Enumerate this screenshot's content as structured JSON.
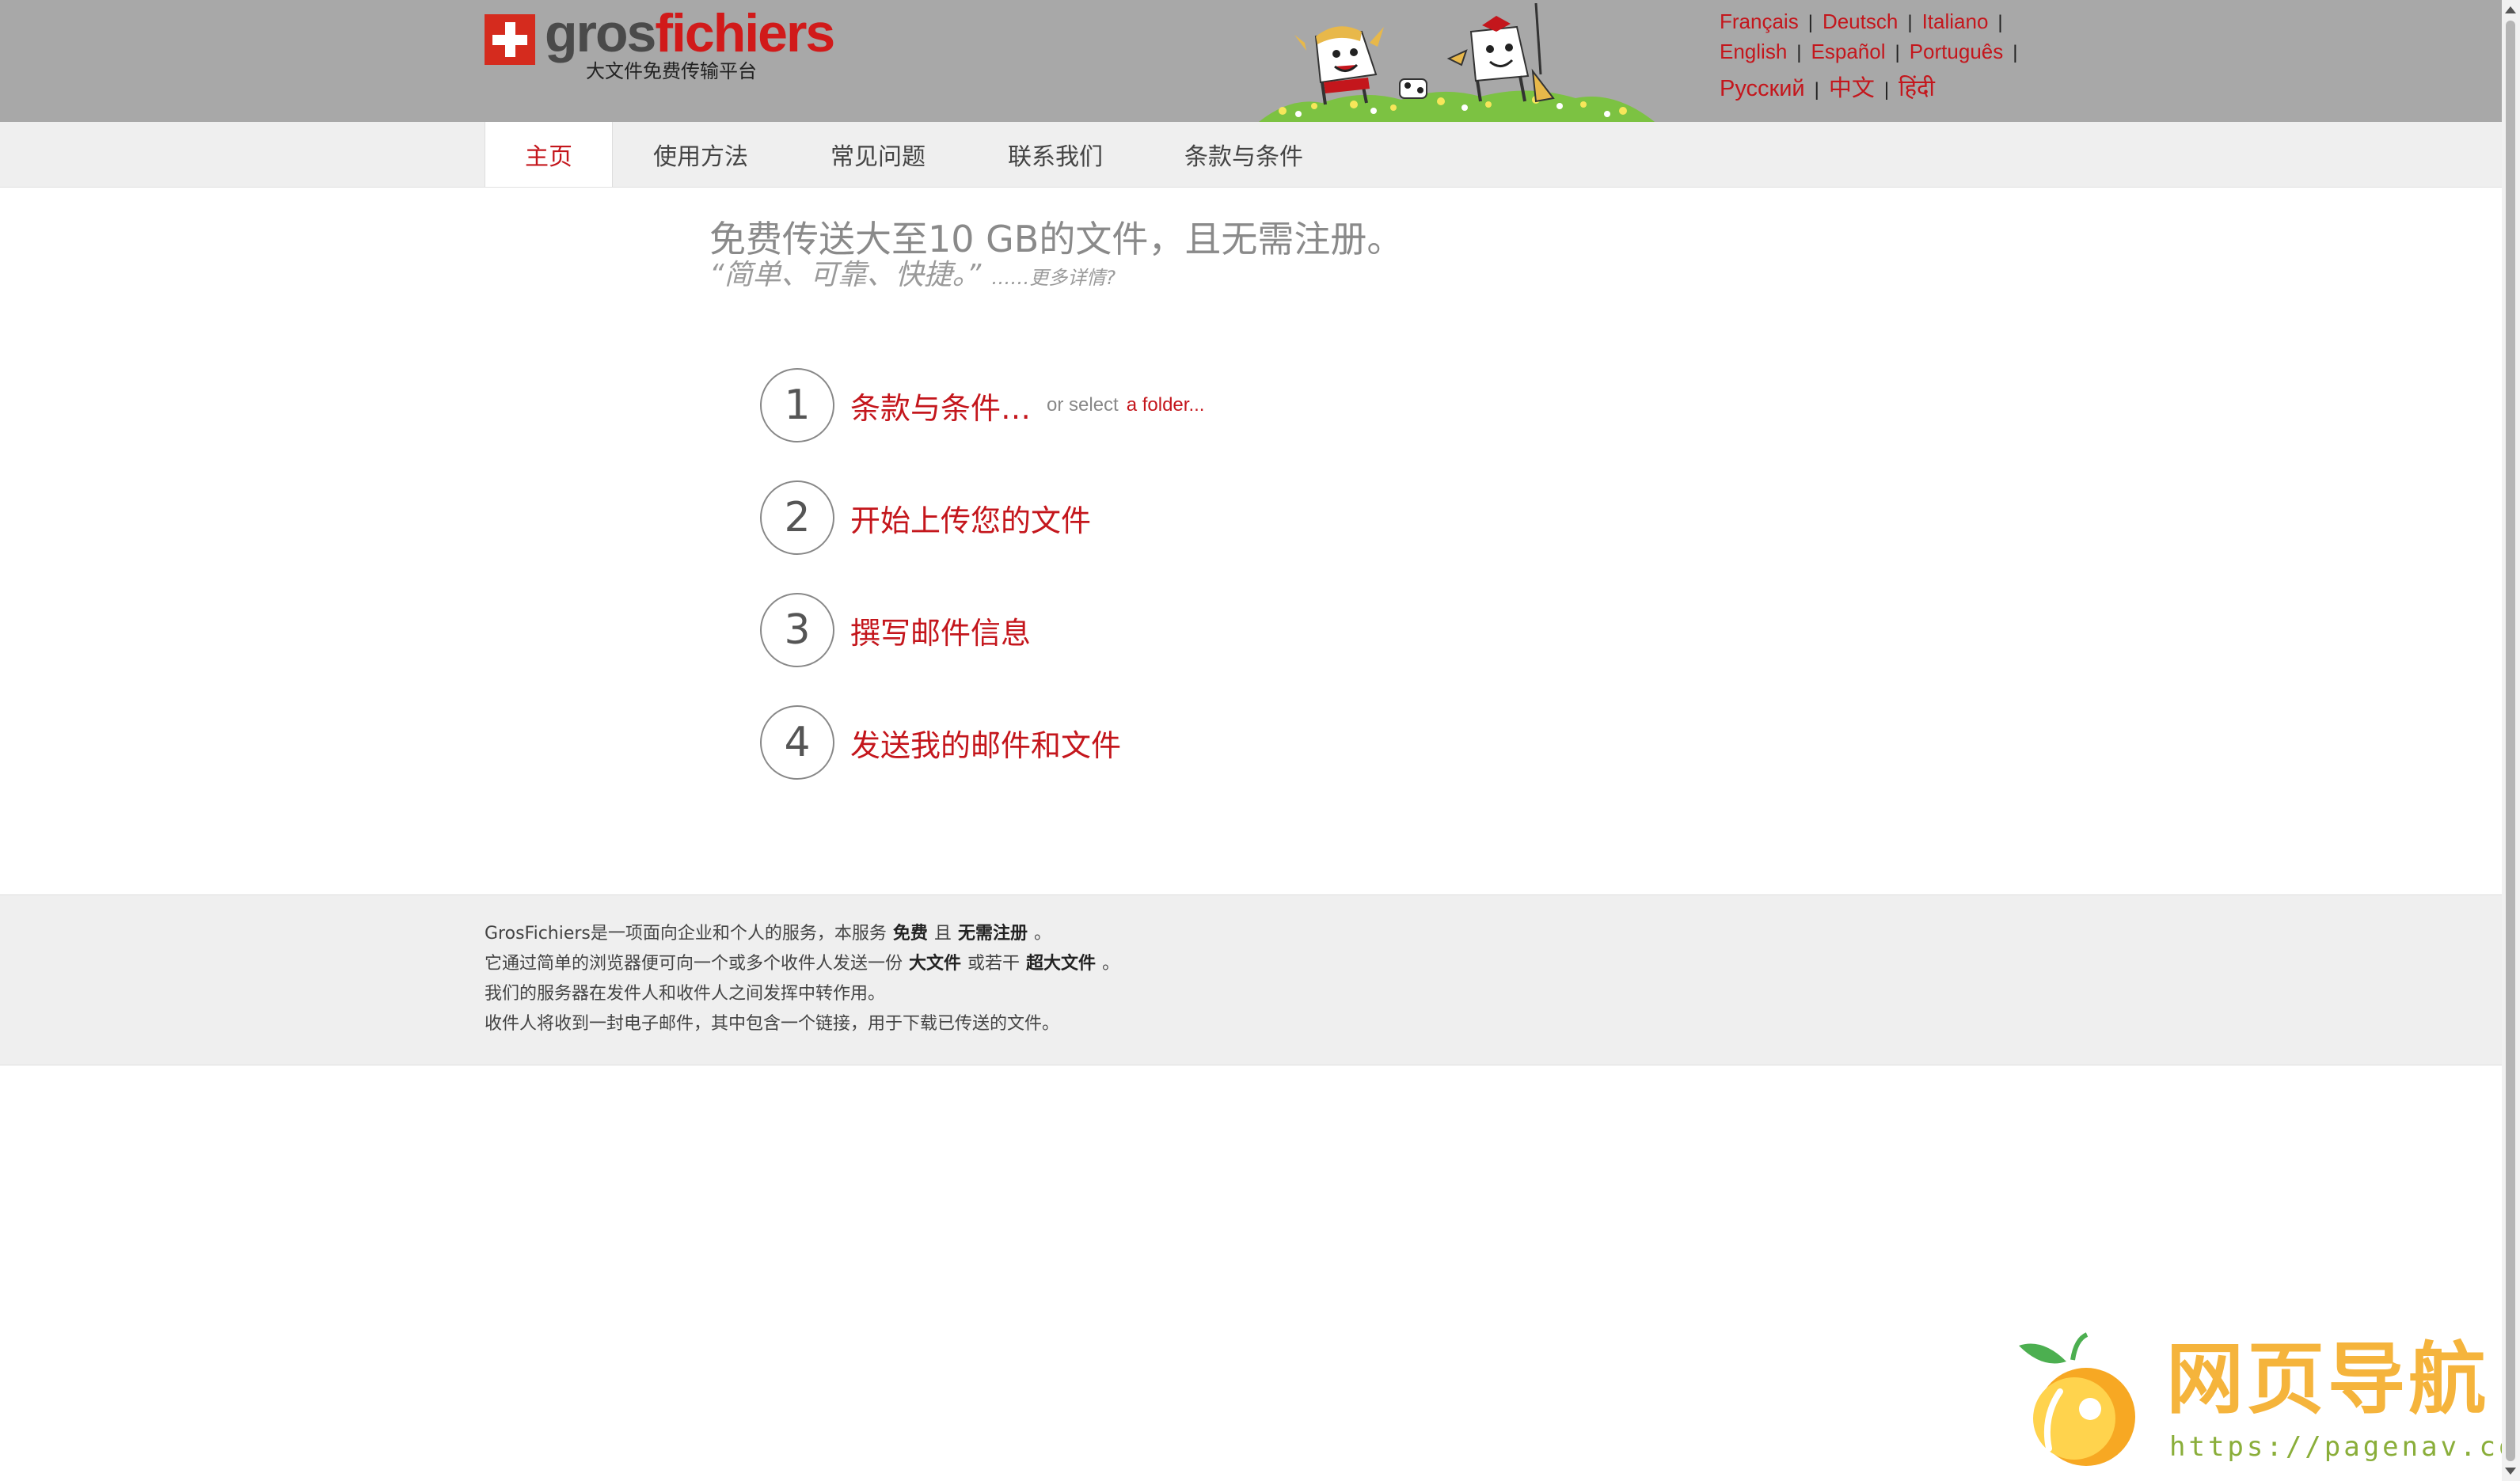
{
  "header": {
    "logo_part1": "gros",
    "logo_part2": "fichiers",
    "tagline": "大文件免费传输平台",
    "languages_row1": [
      "Français",
      "Deutsch",
      "Italiano"
    ],
    "languages_row2": [
      "English",
      "Español",
      "Português"
    ],
    "languages_row3": [
      "Русский",
      "中文",
      "हिंदी"
    ]
  },
  "nav": {
    "tabs": [
      {
        "label": "主页",
        "active": true
      },
      {
        "label": "使用方法",
        "active": false
      },
      {
        "label": "常见问题",
        "active": false
      },
      {
        "label": "联系我们",
        "active": false
      },
      {
        "label": "条款与条件",
        "active": false
      }
    ]
  },
  "main": {
    "headline": "免费传送大至10 GB的文件，且无需注册。",
    "subline_quote": "“简单、可靠、快捷。”",
    "subline_more": "……更多详情?",
    "steps": [
      {
        "number": "1",
        "label": "条款与条件…",
        "extra": "or select",
        "extra_link": "a folder..."
      },
      {
        "number": "2",
        "label": "开始上传您的文件"
      },
      {
        "number": "3",
        "label": "撰写邮件信息"
      },
      {
        "number": "4",
        "label": "发送我的邮件和文件"
      }
    ]
  },
  "footer": {
    "line1_a": "GrosFichiers是一项面向企业和个人的服务，本服务",
    "line1_b": "免费",
    "line1_c": "且",
    "line1_d": "无需注册",
    "line1_e": "。",
    "line2_a": "它通过简单的浏览器便可向一个或多个收件人发送一份",
    "line2_b": "大文件",
    "line2_c": "或若干",
    "line2_d": "超大文件",
    "line2_e": "。",
    "line3": "我们的服务器在发件人和收件人之间发挥中转作用。",
    "line4": "收件人将收到一封电子邮件，其中包含一个链接，用于下载已传送的文件。"
  },
  "watermark": {
    "title": "网页导航",
    "url": "https://pagenav.com"
  },
  "colors": {
    "header_bg": "#a8a8a8",
    "accent_red": "#c4161c",
    "nav_bg": "#efefef",
    "footer_bg": "#efefef",
    "watermark_orange": "#f5b43c",
    "watermark_green": "#8aae3a"
  }
}
